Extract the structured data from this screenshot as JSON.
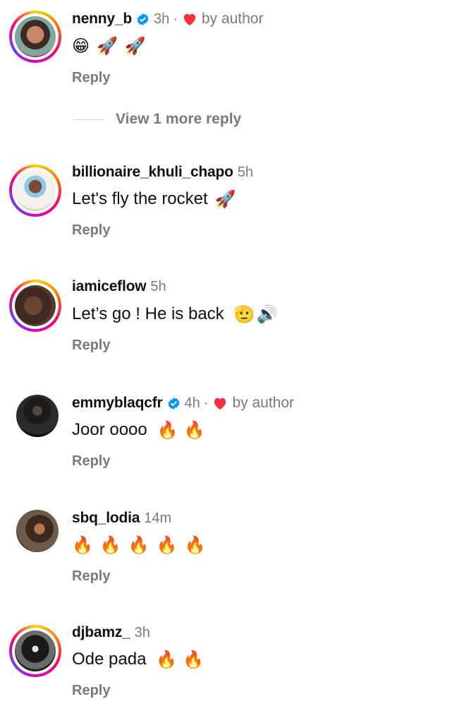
{
  "comments": [
    {
      "username": "nenny_b",
      "verified": true,
      "time": "3h",
      "liked_by_author": true,
      "by_author_label": "by author",
      "text": "",
      "emojis": [
        "😁",
        "🚀",
        "🚀"
      ],
      "reply_label": "Reply",
      "avatar_ring": true
    },
    {
      "username": "billionaire_khuli_chapo",
      "verified": false,
      "time": "5h",
      "text": "Let's fly the rocket",
      "emojis": [
        "🚀"
      ],
      "reply_label": "Reply",
      "avatar_ring": true
    },
    {
      "username": "iamiceflow",
      "verified": false,
      "time": "5h",
      "text": "Let’s go ! He is back",
      "emojis": [
        "🫡",
        "🔊"
      ],
      "reply_label": "Reply",
      "avatar_ring": true
    },
    {
      "username": "emmyblaqcfr",
      "verified": true,
      "time": "4h",
      "liked_by_author": true,
      "by_author_label": "by author",
      "text": "Joor oooo",
      "emojis": [
        "🔥",
        "🔥"
      ],
      "reply_label": "Reply",
      "avatar_ring": false
    },
    {
      "username": "sbq_lodia",
      "verified": false,
      "time": "14m",
      "text": "",
      "emojis": [
        "🔥",
        "🔥",
        "🔥",
        "🔥",
        "🔥"
      ],
      "reply_label": "Reply",
      "avatar_ring": false
    },
    {
      "username": "djbamz_",
      "verified": false,
      "time": "3h",
      "text": "Ode pada",
      "emojis": [
        "🔥",
        "🔥"
      ],
      "reply_label": "Reply",
      "avatar_ring": true
    }
  ],
  "view_more_replies": "View 1 more reply",
  "colors": {
    "verified_blue": "#0095f6",
    "heart_red": "#ff3040",
    "secondary_text": "#7a7a7a"
  }
}
